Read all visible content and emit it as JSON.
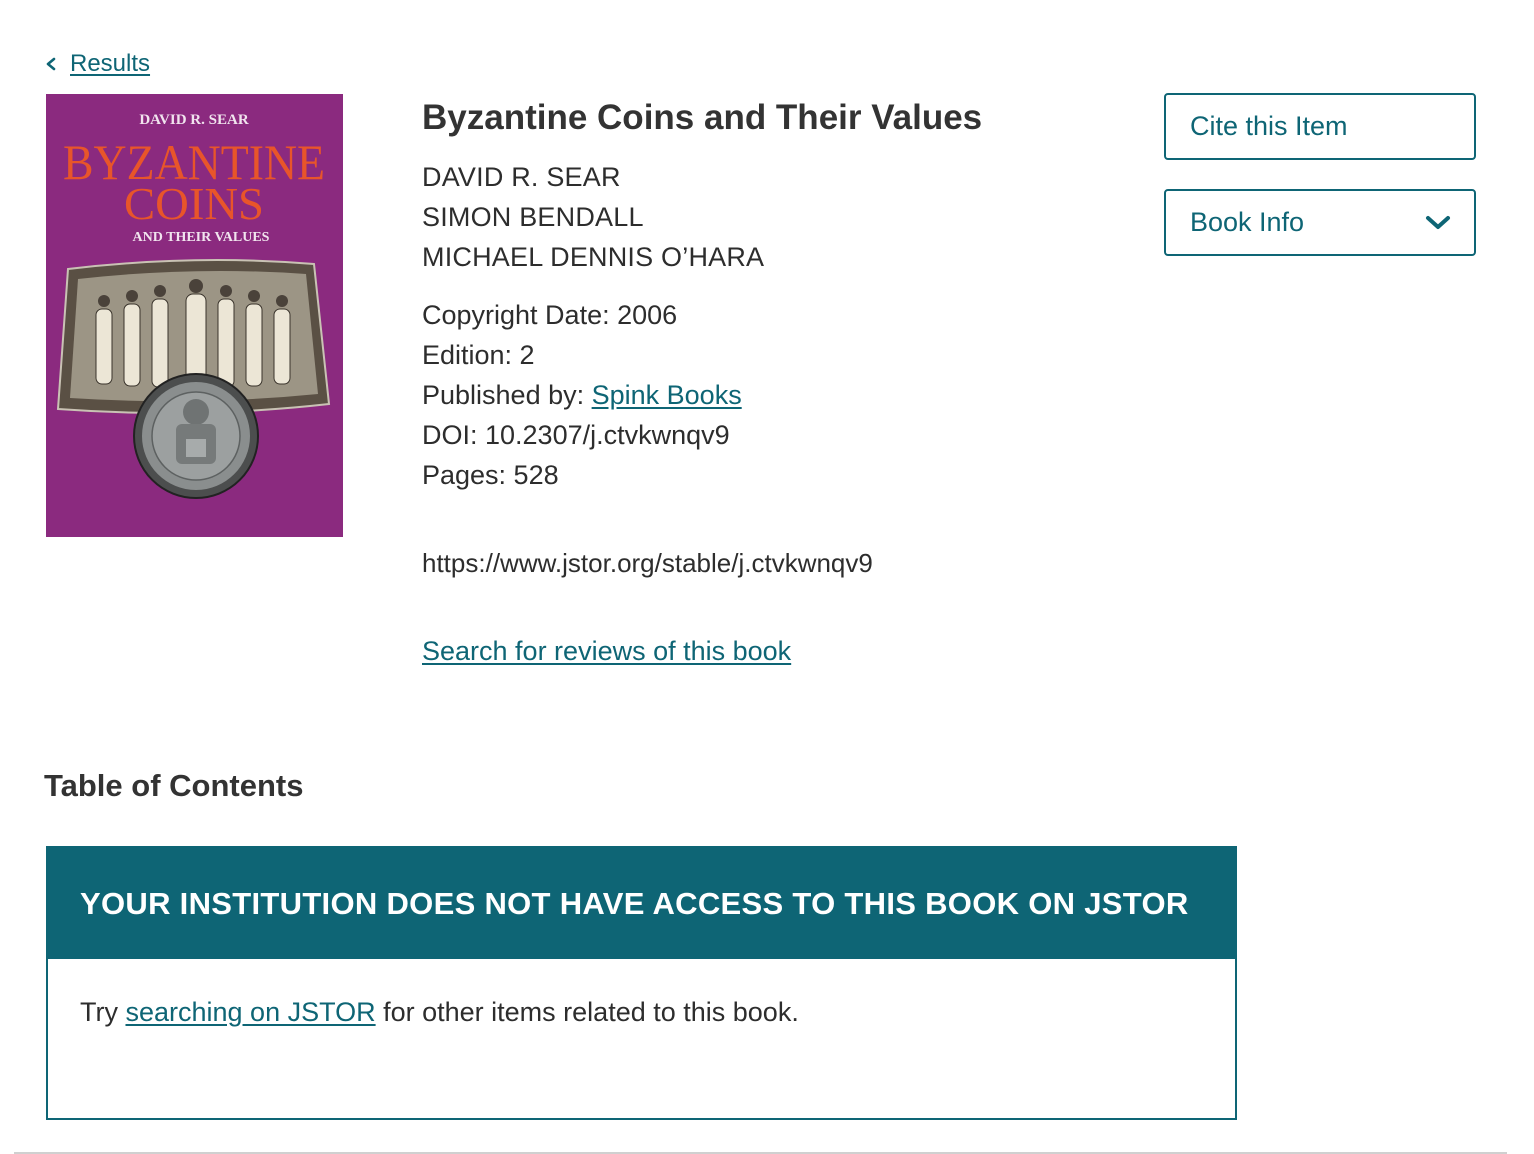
{
  "nav": {
    "back_label": "Results",
    "back_icon": "chevron-left-icon"
  },
  "book": {
    "cover": {
      "author_text": "DAVID R. SEAR",
      "title_line1": "BYZANTINE",
      "title_line2": "COINS",
      "subtitle_text": "AND THEIR VALUES",
      "background_color": "#8b2a7f",
      "title_color": "#e8552a"
    },
    "title": "Byzantine Coins and Their Values",
    "authors": [
      "DAVID R. SEAR",
      "SIMON BENDALL",
      "MICHAEL DENNIS O’HARA"
    ],
    "copyright_label": "Copyright Date: 2006",
    "edition_label": "Edition: 2",
    "published_prefix": "Published by: ",
    "publisher": "Spink Books",
    "doi_label": "DOI: 10.2307/j.ctvkwnqv9",
    "pages_label": "Pages: 528",
    "stable_url": "https://www.jstor.org/stable/j.ctvkwnqv9",
    "reviews_link": "Search for reviews of this book"
  },
  "actions": {
    "cite_label": "Cite this Item",
    "book_info_label": "Book Info",
    "book_info_icon": "chevron-down-icon"
  },
  "toc": {
    "heading": "Table of Contents",
    "access_banner": "YOUR INSTITUTION DOES NOT HAVE ACCESS TO THIS BOOK ON JSTOR",
    "body_prefix": "Try ",
    "body_link": "searching on JSTOR",
    "body_suffix": " for other items related to this book."
  },
  "colors": {
    "accent": "#0e6575",
    "text": "#2d2d2d",
    "banner_text": "#ffffff"
  }
}
